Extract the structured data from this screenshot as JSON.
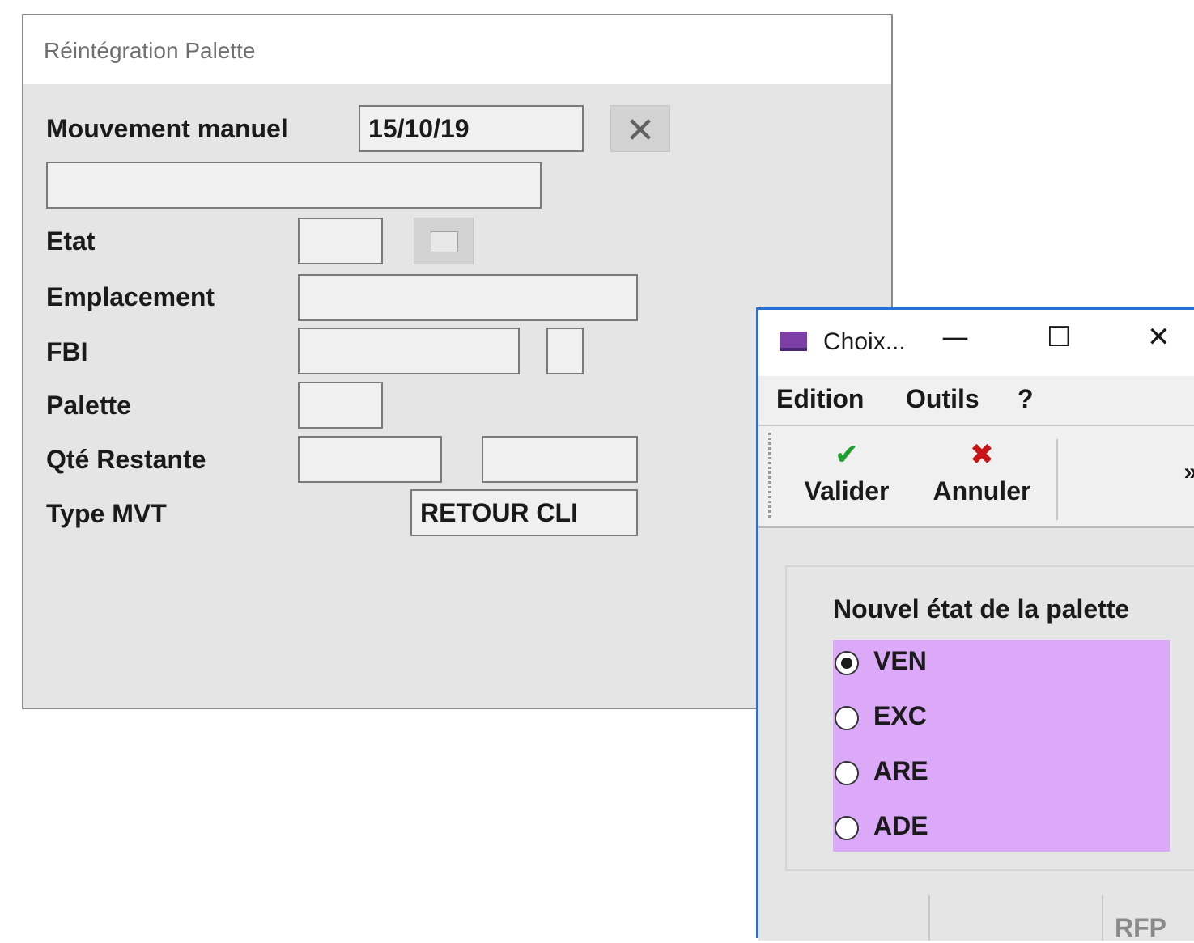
{
  "main_window": {
    "title": "Réintégration Palette",
    "mouvement_manuel": {
      "label": "Mouvement manuel",
      "date_value": "15/10/19"
    },
    "etat": {
      "label": "Etat"
    },
    "emplacement": {
      "label": "Emplacement"
    },
    "fbi": {
      "label": "FBI"
    },
    "palette": {
      "label": "Palette"
    },
    "qte_restante": {
      "label": "Qté Restante"
    },
    "type_mvt": {
      "label": "Type MVT",
      "value": "RETOUR CLI"
    },
    "clear_glyph": "✕"
  },
  "dialog": {
    "title": "Choix...",
    "controls": {
      "minimize": "—",
      "maximize": "☐",
      "close": "✕"
    },
    "menu": [
      "Edition",
      "Outils",
      "?"
    ],
    "toolbar": {
      "valider": {
        "icon": "✔",
        "label": "Valider",
        "color": "#1e9e2e"
      },
      "annuler": {
        "icon": "✖",
        "label": "Annuler",
        "color": "#c81414"
      },
      "overflow": "»"
    },
    "group_title": "Nouvel état de la palette",
    "options": [
      {
        "label": "VEN",
        "selected": true
      },
      {
        "label": "EXC",
        "selected": false
      },
      {
        "label": "ARE",
        "selected": false
      },
      {
        "label": "ADE",
        "selected": false
      }
    ],
    "radio_panel_color": "#dba9f8",
    "status": "RFP"
  }
}
